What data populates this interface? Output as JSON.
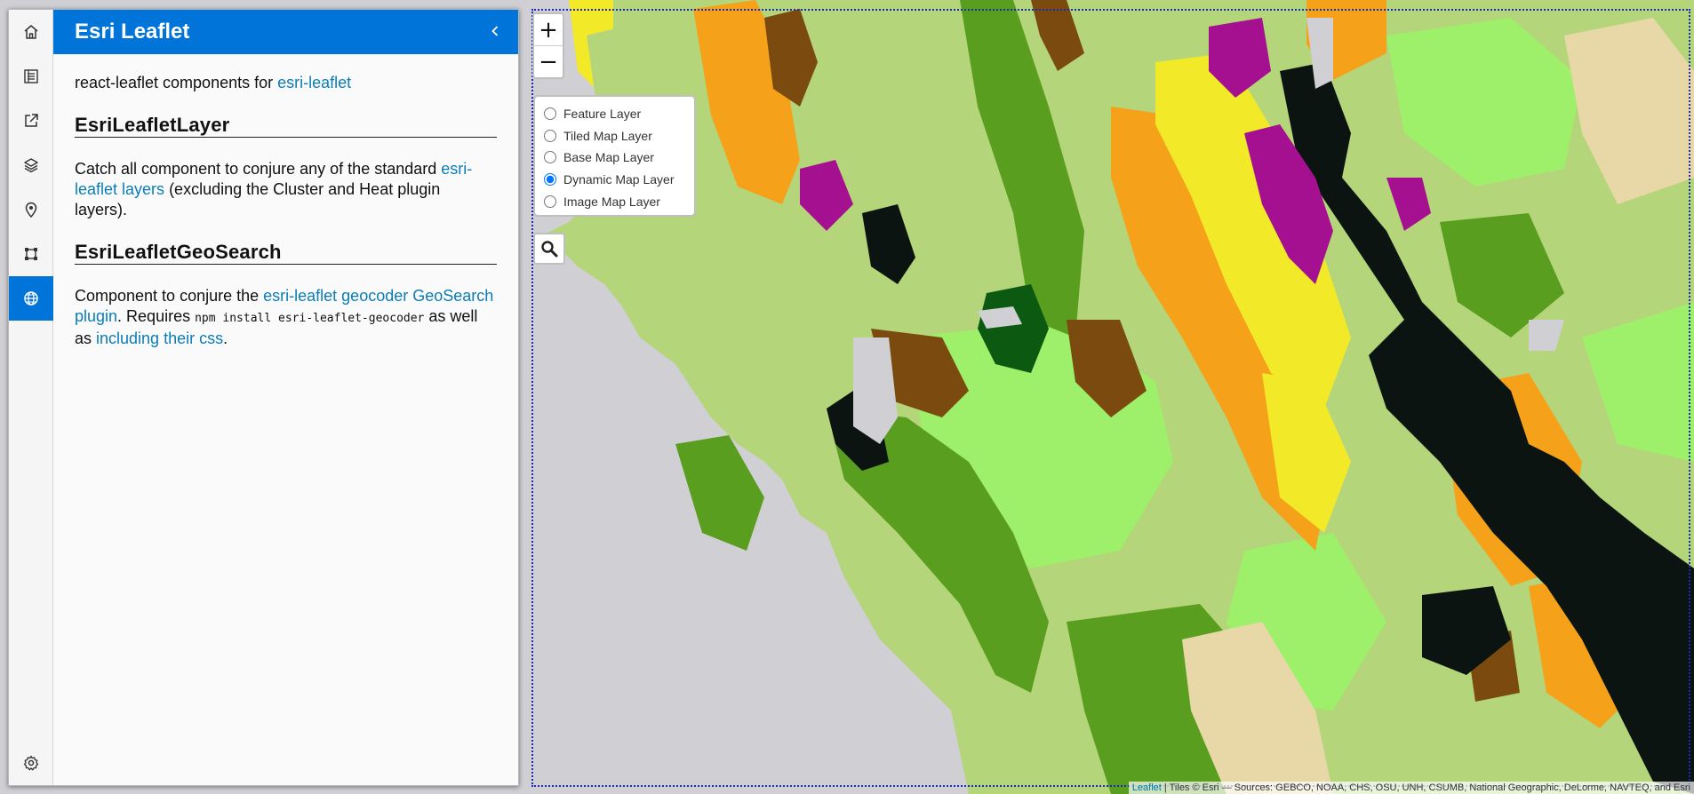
{
  "tabs": [
    {
      "icon": "home-icon"
    },
    {
      "icon": "list-icon"
    },
    {
      "icon": "external-link-icon"
    },
    {
      "icon": "layers-icon"
    },
    {
      "icon": "map-pin-icon"
    },
    {
      "icon": "vector-shape-icon"
    },
    {
      "icon": "globe-icon",
      "active": true
    },
    {
      "icon": "gear-icon"
    }
  ],
  "pane": {
    "title": "Esri Leaflet",
    "intro_text": "react-leaflet components for ",
    "intro_link": "esri-leaflet",
    "section1": {
      "heading": "EsriLeafletLayer",
      "text_before": "Catch all component to conjure any of the standard ",
      "link": "esri-leaflet layers",
      "text_after": " (excluding the Cluster and Heat plugin layers)."
    },
    "section2": {
      "heading": "EsriLeafletGeoSearch",
      "text_before": "Component to conjure the ",
      "link1": "esri-leaflet geocoder GeoSearch plugin",
      "text_mid": ". Requires ",
      "code": "npm install esri-leaflet-geocoder",
      "text_mid2": " as well as ",
      "link2": "including their css",
      "text_after": "."
    }
  },
  "map": {
    "zoom_in": "+",
    "zoom_out": "−",
    "layers": [
      {
        "label": "Feature Layer",
        "checked": false
      },
      {
        "label": "Tiled Map Layer",
        "checked": false
      },
      {
        "label": "Base Map Layer",
        "checked": false
      },
      {
        "label": "Dynamic Map Layer",
        "checked": true
      },
      {
        "label": "Image Map Layer",
        "checked": false
      }
    ],
    "search_icon": "magnifier-icon",
    "attribution_link": "Leaflet",
    "attribution_text": " | Tiles © Esri — Sources: GEBCO, NOAA, CHS, OSU, UNH, CSUMB, National Geographic, DeLorme, NAVTEQ, and Esri"
  },
  "colors": {
    "accent": "#0074d9",
    "water": "#cfcfd4",
    "green_dark": "#5a9e20",
    "green_light": "#b5d57a",
    "green_bright": "#9ef06a",
    "orange": "#f5a21a",
    "yellow": "#f2ea28",
    "brown": "#7a4a0e",
    "black": "#0b1410",
    "magenta": "#a4108f",
    "forest": "#0c5a12",
    "tan": "#e8d8a8"
  }
}
